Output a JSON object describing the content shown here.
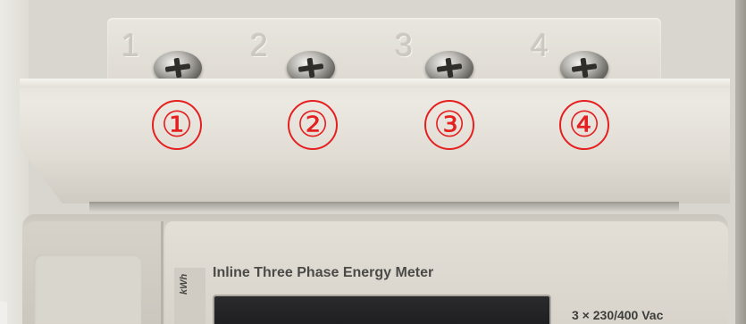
{
  "terminal_numbers": [
    "1",
    "2",
    "3",
    "4"
  ],
  "markers": [
    "①",
    "②",
    "③",
    "④"
  ],
  "marker_color": "#e52020",
  "meter": {
    "title": "Inline Three Phase Energy Meter",
    "voltage": "3 × 230/400 Vac",
    "side_label": "kWh"
  }
}
